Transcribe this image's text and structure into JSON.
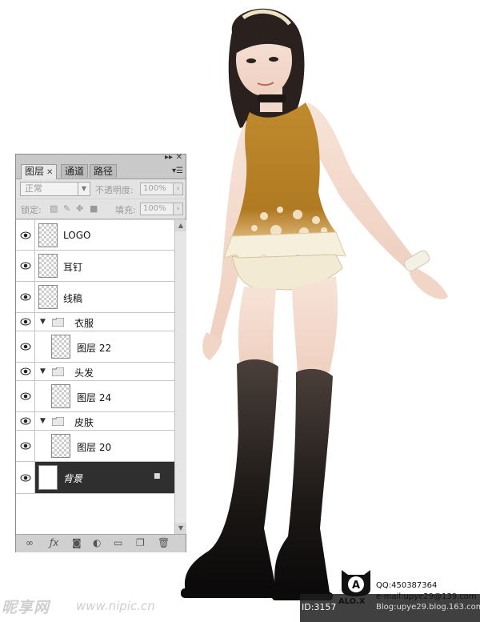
{
  "panel": {
    "tabs": [
      "图层",
      "通道",
      "路径"
    ],
    "blend_mode": "正常",
    "opacity_label": "不透明度:",
    "opacity_value": "100%",
    "lock_label": "锁定:",
    "fill_label": "填充:",
    "fill_value": "100%",
    "layers": [
      {
        "name": "LOGO"
      },
      {
        "name": "耳钉"
      },
      {
        "name": "线稿"
      },
      {
        "name": "衣服"
      },
      {
        "name": "图层 22"
      },
      {
        "name": "头发"
      },
      {
        "name": "图层 24"
      },
      {
        "name": "皮肤"
      },
      {
        "name": "图层 20"
      },
      {
        "name": "背景"
      }
    ]
  },
  "logo": {
    "mark": "A",
    "name": "ALO.X"
  },
  "contact": {
    "qq": "QQ:450387364",
    "email": "e-mail:upye29@139.com",
    "blog": "Blog:upye29.blog.163.com"
  },
  "watermark": {
    "brand": "昵享网",
    "url": "www.nipic.cn"
  },
  "image_id": "ID:3157"
}
